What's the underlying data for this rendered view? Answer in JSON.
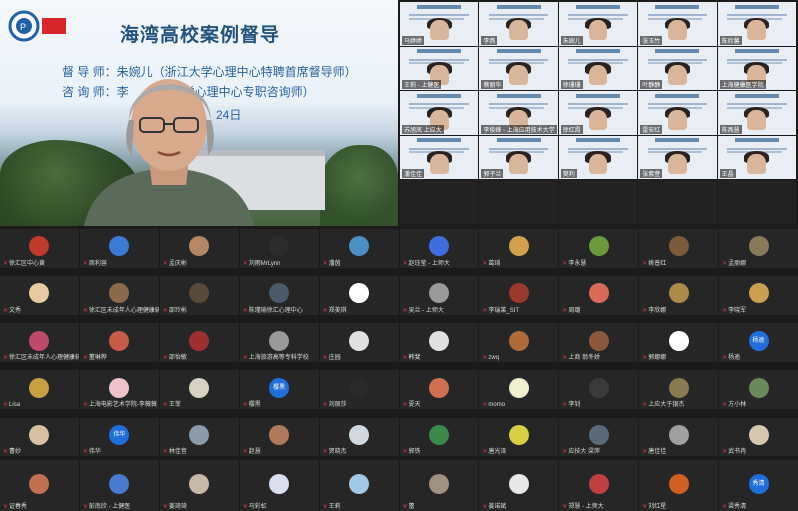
{
  "speaker": {
    "title": "海湾高校案例督导",
    "supervisor_line": "督 导 师：朱婉儿（浙江大学心理中心特聘首席督导师）",
    "consultant_line": "咨 询 师：李　　（　大学心理中心专职咨询师）",
    "date_fragment": "24日"
  },
  "mini_tiles": [
    {
      "name": "马婷婷"
    },
    {
      "name": "李燕"
    },
    {
      "name": "朱婉儿"
    },
    {
      "name": "张玉竹"
    },
    {
      "name": "陈欣馨"
    },
    {
      "name": "王莉 - 上健医"
    },
    {
      "name": "蔡丽华"
    },
    {
      "name": "徐珊珊"
    },
    {
      "name": "叶静静"
    },
    {
      "name": "上海健康医学院"
    },
    {
      "name": "苏旭凤 上应大"
    },
    {
      "name": "李俊峰 - 上海应用技术大学"
    },
    {
      "name": "徐红霞"
    },
    {
      "name": "雷安红"
    },
    {
      "name": "陈燕慧"
    },
    {
      "name": "潘佳佳"
    },
    {
      "name": "郭子兰"
    },
    {
      "name": "樊利"
    },
    {
      "name": "张紫萱"
    },
    {
      "name": "王晶"
    },
    {
      "name": ""
    },
    {
      "name": ""
    },
    {
      "name": ""
    },
    {
      "name": ""
    },
    {
      "name": ""
    }
  ],
  "participants": [
    {
      "name": "徐汇区中心黄",
      "avatar": "#c0392b"
    },
    {
      "name": "商利容",
      "avatar": "#3a7bd5"
    },
    {
      "name": "孟庆彬",
      "avatar": "#b58863"
    },
    {
      "name": "刘雨MrLynn",
      "avatar": "#2c2c2c"
    },
    {
      "name": "潘茵",
      "avatar": "#4a90c2"
    },
    {
      "name": "赵珏莹 - 上师大",
      "avatar": "#3d6fe0"
    },
    {
      "name": "葛琦",
      "avatar": "#d4a04a"
    },
    {
      "name": "李永慧",
      "avatar": "#6a9a3a"
    },
    {
      "name": "姚普红",
      "avatar": "#7c5a3a"
    },
    {
      "name": "孟丽娜",
      "avatar": "#8a7a5a"
    },
    {
      "name": "文秀",
      "avatar": "#e8c9a0"
    },
    {
      "name": "徐汇区未成年人心理健康辅导...",
      "avatar": "#8c6a4a"
    },
    {
      "name": "邵玲彬",
      "avatar": "#5a4a3a"
    },
    {
      "name": "陈瑾瑜徐汇心理中心",
      "avatar": "#4a5a6a"
    },
    {
      "name": "郑美琪",
      "avatar": "#ffffff"
    },
    {
      "name": "吴兰 - 上师大",
      "avatar": "#9a9a9a"
    },
    {
      "name": "李瑞莱_SIT",
      "avatar": "#9a3a2a"
    },
    {
      "name": "周璐",
      "avatar": "#d96a5a"
    },
    {
      "name": "李欣娜",
      "avatar": "#b08a4a"
    },
    {
      "name": "李晓军",
      "avatar": "#c8a050"
    },
    {
      "name": "徐汇区未成年人心理健康辅导...",
      "avatar": "#c04a6a"
    },
    {
      "name": "董琳桦",
      "avatar": "#c85a4a"
    },
    {
      "name": "邵怡敏",
      "avatar": "#a03030"
    },
    {
      "name": "上海旅游高等专科学校",
      "avatar": "#9a9a9a"
    },
    {
      "name": "庄园",
      "avatar": "#e0e0e0"
    },
    {
      "name": "韩斐",
      "avatar": "#e0e0e0"
    },
    {
      "name": "zwq",
      "avatar": "#b06a3a"
    },
    {
      "name": "上商 翁冬娇",
      "avatar": "#8a5a3a"
    },
    {
      "name": "郭娜娜",
      "avatar": "#ffffff"
    },
    {
      "name": "杨逾",
      "avatar_text": "杨逾"
    },
    {
      "name": "Lisa",
      "avatar": "#c8a040"
    },
    {
      "name": "上海电影艺术学院-李薇薇",
      "avatar": "#f0c0c8"
    },
    {
      "name": "王菲",
      "avatar": "#d8d0c0"
    },
    {
      "name": "樱黑",
      "avatar_text": "樱黑"
    },
    {
      "name": "刘丽莎",
      "avatar": "#2a2a2a"
    },
    {
      "name": "夏天",
      "avatar": "#d07050"
    },
    {
      "name": "momo",
      "avatar": "#f0f0d0"
    },
    {
      "name": "李钊",
      "avatar": "#3a3a3a"
    },
    {
      "name": "上应大于银杰",
      "avatar": "#8a7a50"
    },
    {
      "name": "方小林",
      "avatar": "#6a8a5a"
    },
    {
      "name": "曹妙",
      "avatar": "#d8c0a0"
    },
    {
      "name": "伟华",
      "avatar_text": "伟华"
    },
    {
      "name": "林佳音",
      "avatar": "#8a9aaa"
    },
    {
      "name": "赵慧",
      "avatar": "#b07a5a"
    },
    {
      "name": "贺晓杰",
      "avatar": "#d0d8e0"
    },
    {
      "name": "郭铁",
      "avatar": "#3a8a4a"
    },
    {
      "name": "唐光泽",
      "avatar": "#d8d040"
    },
    {
      "name": "应技大 梁萍",
      "avatar": "#5a6a7a"
    },
    {
      "name": "唐佳佳",
      "avatar": "#a0a0a0"
    },
    {
      "name": "武书冉",
      "avatar": "#d8c8b0"
    },
    {
      "name": "蓉",
      "avatar": "#c0a070"
    },
    {
      "name": "",
      "avatar": "#262626"
    },
    {
      "name": "",
      "avatar": "#262626"
    },
    {
      "name": "",
      "avatar": "#262626"
    },
    {
      "name": "",
      "avatar": "#262626"
    },
    {
      "name": "",
      "avatar": "#262626"
    },
    {
      "name": "",
      "avatar": "#262626"
    },
    {
      "name": "",
      "avatar": "#262626"
    },
    {
      "name": "",
      "avatar": "#262626"
    },
    {
      "name": "",
      "avatar": "#262626"
    }
  ],
  "bottom_row": [
    {
      "name": "证春秀",
      "avatar": "#c07050"
    },
    {
      "name": "彭南欣 - 上健医",
      "avatar": "#4a7ad0"
    },
    {
      "name": "姜琦琦",
      "avatar": "#c8b8a8"
    },
    {
      "name": "马彩虹",
      "avatar": "#d8e0f0"
    },
    {
      "name": "王莉",
      "avatar": "#a0c8e8"
    },
    {
      "name": "蕾",
      "avatar": "#a09080"
    },
    {
      "name": "姜诺斌",
      "avatar": "#e8e8e8"
    },
    {
      "name": "郑慧 - 上师大",
      "avatar": "#c04040"
    },
    {
      "name": "刘红星",
      "avatar": "#d06020"
    },
    {
      "name": "梁秀清",
      "avatar_text": "秀清"
    }
  ]
}
